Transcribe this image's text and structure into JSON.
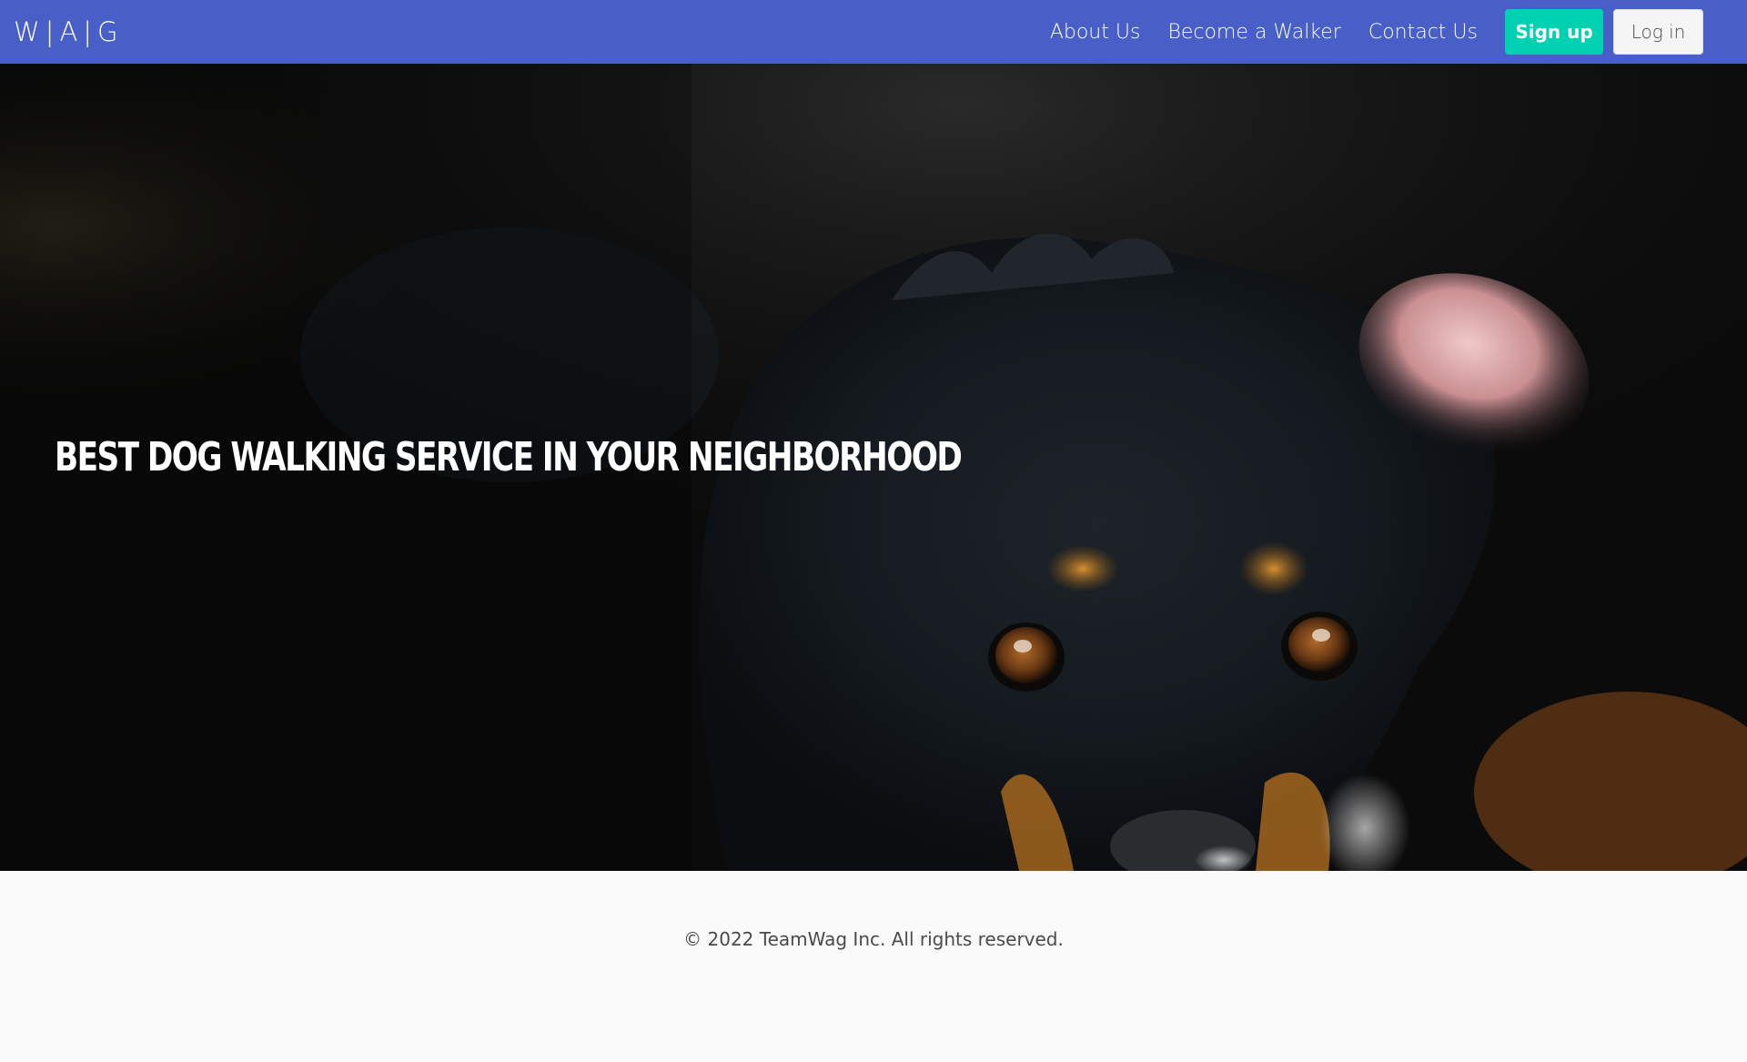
{
  "navbar": {
    "brand": "W|A|G",
    "links": [
      {
        "label": "About Us"
      },
      {
        "label": "Become a Walker"
      },
      {
        "label": "Contact Us"
      }
    ],
    "signup_label": "Sign up",
    "login_label": "Log in"
  },
  "hero": {
    "title": "Best dog walking service in your neighborhood"
  },
  "footer": {
    "copyright": "© 2022 TeamWag Inc. All rights reserved."
  },
  "colors": {
    "navbar": "#485fc7",
    "primary_button": "#00d1b2",
    "light_button": "#f5f5f5",
    "footer_bg": "#fafafa"
  }
}
